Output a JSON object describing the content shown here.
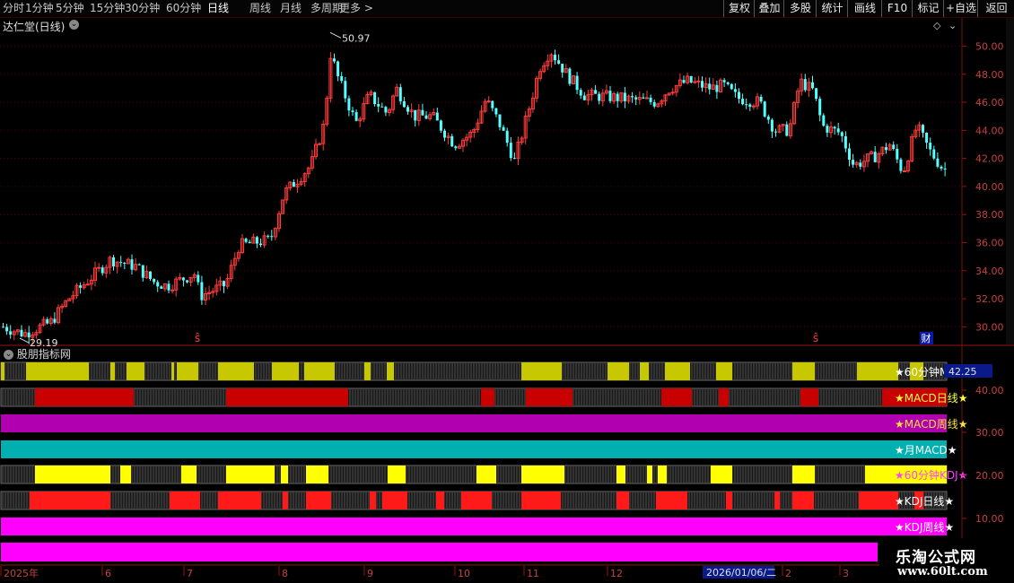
{
  "toolbar": {
    "periods": [
      "分时",
      "1分钟",
      "5分钟",
      "15分钟",
      "30分钟",
      "60分钟",
      "日线",
      "周线",
      "月线",
      "多周期",
      "更多 >"
    ],
    "active_period": "日线",
    "actions": [
      "复权",
      "叠加",
      "多股",
      "统计",
      "画线",
      "F10",
      "标记",
      "+自选",
      "返回"
    ]
  },
  "stock": {
    "title": "达仁堂(日线)",
    "high_label": "50.97",
    "low_label": "29.19",
    "fin_marker": "财",
    "signal_marker": "ŝ"
  },
  "price_axis": {
    "ticks": [
      "50.00",
      "48.00",
      "46.00",
      "44.00",
      "42.00",
      "40.00",
      "38.00",
      "36.00",
      "34.00",
      "32.00",
      "30.00"
    ],
    "min": 29.0,
    "max": 51.5
  },
  "indicator_panel": {
    "title": "股朋指标网",
    "bars": [
      {
        "label": "★60分钟MACD",
        "color": "#c8c800"
      },
      {
        "label": "★MACD日线★",
        "color": "#c80000"
      },
      {
        "label": "★MACD周线★",
        "color": "#b000b0"
      },
      {
        "label": "★月MACD★",
        "color": "#00b0b0"
      },
      {
        "label": "★60分钟KDJ★",
        "color": "#ffff00"
      },
      {
        "label": "★KDJ日线★",
        "color": "#ff1a1a"
      },
      {
        "label": "★KDJ周线★",
        "color": "#ff00ff"
      },
      {
        "label": "",
        "color": "#ff00ff"
      }
    ],
    "value_box": "42.25",
    "axis_ticks": [
      "40.00",
      "30.00",
      "20.00",
      "10.00"
    ]
  },
  "time_axis": {
    "labels": [
      "2025年",
      "6",
      "7",
      "8",
      "9",
      "10",
      "11",
      "12",
      "2",
      "3"
    ],
    "cursor_date": "2026/01/06/二"
  },
  "watermark": {
    "line1": "乐淘公式网",
    "line2": "www.60lt.com"
  },
  "colors": {
    "up": "#ff3c3c",
    "down": "#54ffff",
    "grid": "#5a0000",
    "axis_text": "#c84040"
  }
}
